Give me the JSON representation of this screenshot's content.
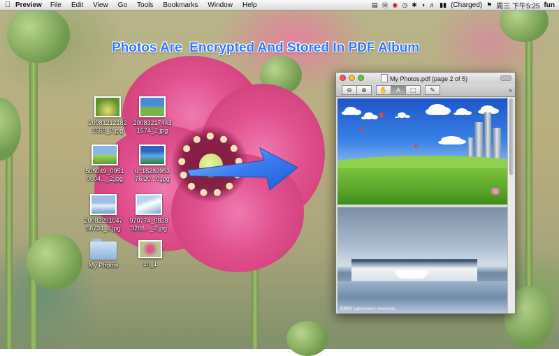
{
  "menubar": {
    "app_name": "Preview",
    "menus": [
      "File",
      "Edit",
      "View",
      "Go",
      "Tools",
      "Bookmarks",
      "Window",
      "Help"
    ],
    "battery_status": "(Charged)",
    "clock": "周三 下午5:25",
    "user": "fun"
  },
  "banner": {
    "text": "Photos Are  Encrypted And Stored In PDF Album",
    "color": "#2f78ff"
  },
  "desktop_icons": [
    {
      "label": "20081212182\n1559_2.jpg"
    },
    {
      "label": "20083217443\n1674_2.jpg"
    },
    {
      "label": "505049_0951\n0004..._2.jpg"
    },
    {
      "label": "u=15289953\n76.20...0.jpg"
    },
    {
      "label": "20082291047\n56734_2.jpg"
    },
    {
      "label": "970774_0838\n3288..._2.jpg"
    },
    {
      "label": "My Photos"
    },
    {
      "label": "cn_1"
    }
  ],
  "window": {
    "title": "My Photos.pdf (page 2 of 5)",
    "toolbar_more": "»"
  },
  "photo_caption": "美图网 tupian.com / www.tuan"
}
